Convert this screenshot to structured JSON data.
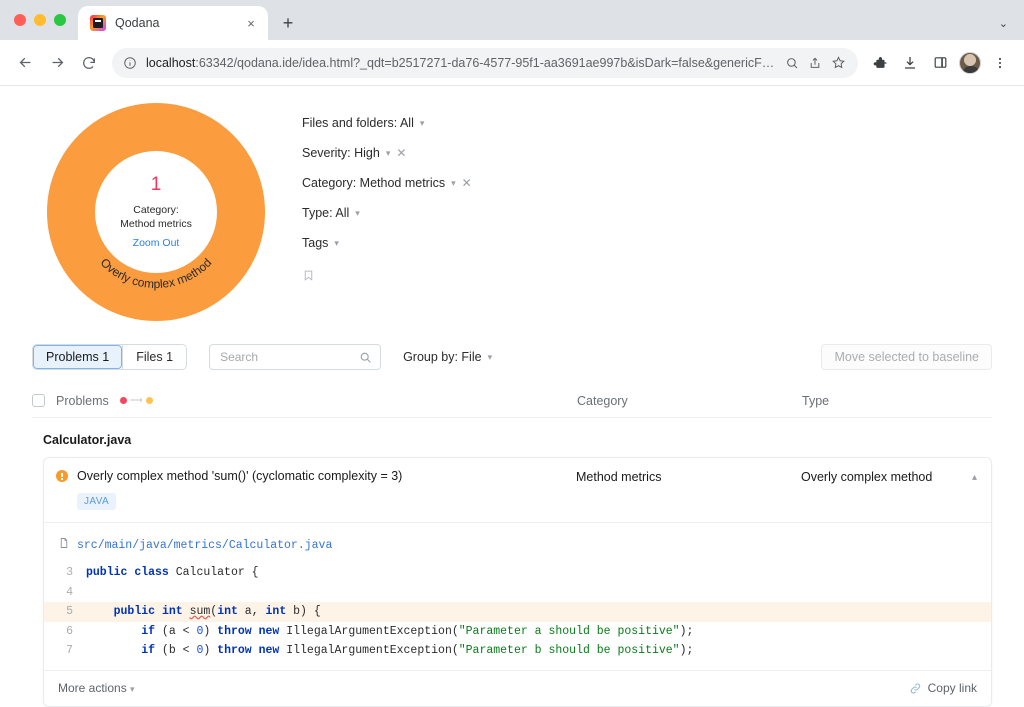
{
  "browser": {
    "tab": {
      "title": "Qodana",
      "favicon": "qodana-icon",
      "close": "×"
    },
    "new_tab": "+",
    "window_chevron": "⌄",
    "url_host": "localhost",
    "url_rest": ":63342/qodana.ide/idea.html?_qdt=b2517271-da76-4577-95f1-aa3691ae997b&isDark=false&genericF…",
    "icons": {
      "back": "back-arrow-icon",
      "forward": "forward-arrow-icon",
      "reload": "reload-icon",
      "info": "site-info-icon",
      "zoom": "page-zoom-icon",
      "share": "share-icon",
      "bookmark": "star-icon",
      "extensions": "puzzle-icon",
      "downloads": "download-icon",
      "sidepanel": "side-panel-icon",
      "profile": "avatar-icon",
      "menu": "three-dot-menu-icon"
    }
  },
  "chart_data": {
    "type": "pie",
    "title": "Category: Method metrics",
    "center_value": "1",
    "center_label_line1": "Category:",
    "center_label_line2": "Method metrics",
    "zoom_out": "Zoom Out",
    "arc_label": "Overly complex method",
    "categories": [
      "Overly complex method"
    ],
    "values": [
      1
    ],
    "colors": [
      "#fb9d3f"
    ],
    "total": 1,
    "legend": "none"
  },
  "filters": [
    {
      "label": "Files and folders: All",
      "caret": true,
      "clear": false
    },
    {
      "label": "Severity: High",
      "caret": true,
      "clear": true
    },
    {
      "label": "Category: Method metrics",
      "caret": true,
      "clear": true
    },
    {
      "label": "Type: All",
      "caret": true,
      "clear": false
    },
    {
      "label": "Tags",
      "caret": true,
      "clear": false
    }
  ],
  "bookmark_icon": "bookmark-icon",
  "toolbar": {
    "tab_problems": "Problems 1",
    "tab_files": "Files 1",
    "search_placeholder": "Search",
    "search_value": "",
    "search_icon": "search-icon",
    "group_by": "Group by: File",
    "baseline_button": "Move selected to baseline"
  },
  "table": {
    "col_problems": "Problems",
    "col_category": "Category",
    "col_type": "Type",
    "severity_dots": [
      "#f5455f",
      "#fec34e"
    ],
    "group_name": "Calculator.java",
    "row": {
      "severity": "warning-icon",
      "title": "Overly complex method 'sum()' (cyclomatic complexity = 3)",
      "badge": "JAVA",
      "category": "Method metrics",
      "type": "Overly complex method",
      "collapse": "⌃"
    }
  },
  "snippet": {
    "path": "src/main/java/metrics/Calculator.java",
    "file_icon": "file-icon",
    "lines": [
      {
        "num": "3",
        "highlight": false,
        "tokens": [
          {
            "t": "",
            "c": "plain"
          },
          {
            "t": "public",
            "c": "kw"
          },
          {
            "t": " ",
            "c": "plain"
          },
          {
            "t": "class",
            "c": "kw"
          },
          {
            "t": " Calculator {",
            "c": "plain"
          }
        ]
      },
      {
        "num": "4",
        "highlight": false,
        "tokens": [
          {
            "t": "",
            "c": "plain"
          }
        ]
      },
      {
        "num": "5",
        "highlight": true,
        "tokens": [
          {
            "t": "    ",
            "c": "plain"
          },
          {
            "t": "public",
            "c": "kw"
          },
          {
            "t": " ",
            "c": "plain"
          },
          {
            "t": "int",
            "c": "kw"
          },
          {
            "t": " ",
            "c": "plain"
          },
          {
            "t": "sum",
            "c": "err"
          },
          {
            "t": "(",
            "c": "plain"
          },
          {
            "t": "int",
            "c": "kw"
          },
          {
            "t": " a, ",
            "c": "plain"
          },
          {
            "t": "int",
            "c": "kw"
          },
          {
            "t": " b) {",
            "c": "plain"
          }
        ]
      },
      {
        "num": "6",
        "highlight": false,
        "tokens": [
          {
            "t": "        ",
            "c": "plain"
          },
          {
            "t": "if",
            "c": "kw"
          },
          {
            "t": " (a < ",
            "c": "plain"
          },
          {
            "t": "0",
            "c": "num"
          },
          {
            "t": ") ",
            "c": "plain"
          },
          {
            "t": "throw",
            "c": "kw"
          },
          {
            "t": " ",
            "c": "plain"
          },
          {
            "t": "new",
            "c": "kw"
          },
          {
            "t": " IllegalArgumentException(",
            "c": "plain"
          },
          {
            "t": "\"Parameter a should be positive\"",
            "c": "str"
          },
          {
            "t": ");",
            "c": "plain"
          }
        ]
      },
      {
        "num": "7",
        "highlight": false,
        "tokens": [
          {
            "t": "        ",
            "c": "plain"
          },
          {
            "t": "if",
            "c": "kw"
          },
          {
            "t": " (b < ",
            "c": "plain"
          },
          {
            "t": "0",
            "c": "num"
          },
          {
            "t": ") ",
            "c": "plain"
          },
          {
            "t": "throw",
            "c": "kw"
          },
          {
            "t": " ",
            "c": "plain"
          },
          {
            "t": "new",
            "c": "kw"
          },
          {
            "t": " IllegalArgumentException(",
            "c": "plain"
          },
          {
            "t": "\"Parameter b should be positive\"",
            "c": "str"
          },
          {
            "t": ");",
            "c": "plain"
          }
        ]
      }
    ]
  },
  "footer": {
    "more_actions": "More actions",
    "copy_link": "Copy link",
    "link_icon": "link-icon"
  },
  "colors": {
    "accent_orange": "#fb9d3f",
    "value_red": "#f0375b",
    "link_blue": "#2a7ee8",
    "highlight_row": "#fdf3e7"
  }
}
